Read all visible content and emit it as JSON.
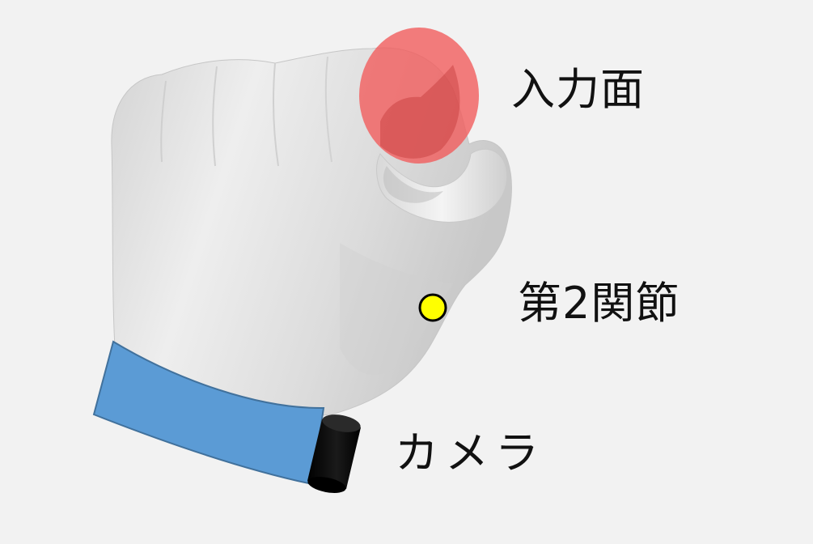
{
  "labels": {
    "input_surface": "入力面",
    "second_joint": "第2関節",
    "camera": "カメラ"
  },
  "colors": {
    "background": "#f2f2f2",
    "input_surface_marker": "#f25a5a",
    "joint_marker": "#ffff00",
    "cuff": "#5b9bd5",
    "camera": "#000000"
  }
}
